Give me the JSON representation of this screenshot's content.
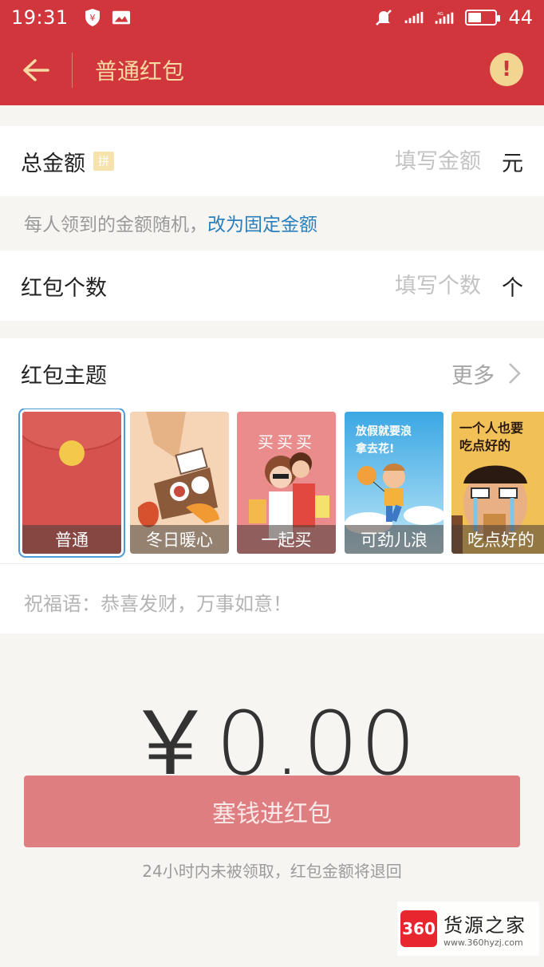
{
  "status_bar": {
    "time": "19:31",
    "battery_level": "44",
    "battery_fill_fraction": 0.44
  },
  "header": {
    "title": "普通红包",
    "back_icon": "arrow-left-icon",
    "info_icon": "exclamation-icon"
  },
  "amount_row": {
    "label": "总金额",
    "badge": "拼",
    "placeholder": "填写金额",
    "unit": "元"
  },
  "amount_hint": {
    "text": "每人领到的金额随机，",
    "link": "改为固定金额"
  },
  "count_row": {
    "label": "红包个数",
    "placeholder": "填写个数",
    "unit": "个"
  },
  "theme_section": {
    "title": "红包主题",
    "more_label": "更多",
    "items": [
      {
        "label": "普通",
        "selected": true
      },
      {
        "label": "冬日暖心",
        "selected": false
      },
      {
        "label": "一起买",
        "selected": false
      },
      {
        "label": "可劲儿浪",
        "selected": false
      },
      {
        "label": "吃点好的",
        "selected": false
      }
    ],
    "art_text": {
      "buy": "买买买",
      "vacation": "放假就要浪\n拿去花!",
      "food": "一个人也要\n吃点好的"
    }
  },
  "blessing": {
    "placeholder": "祝福语：恭喜发财，万事如意！"
  },
  "total": {
    "display": "￥0.00"
  },
  "submit_button": {
    "label": "塞钱进红包"
  },
  "footnote": "24小时内未被领取，红包金额将退回",
  "watermark": {
    "badge": "360",
    "title": "货源之家",
    "url": "www.360hyzj.com"
  },
  "colors": {
    "brand_red": "#d1363c",
    "gold": "#f7d9a3",
    "link_blue": "#2a7fbd",
    "button_disabled": "#de7e80"
  }
}
